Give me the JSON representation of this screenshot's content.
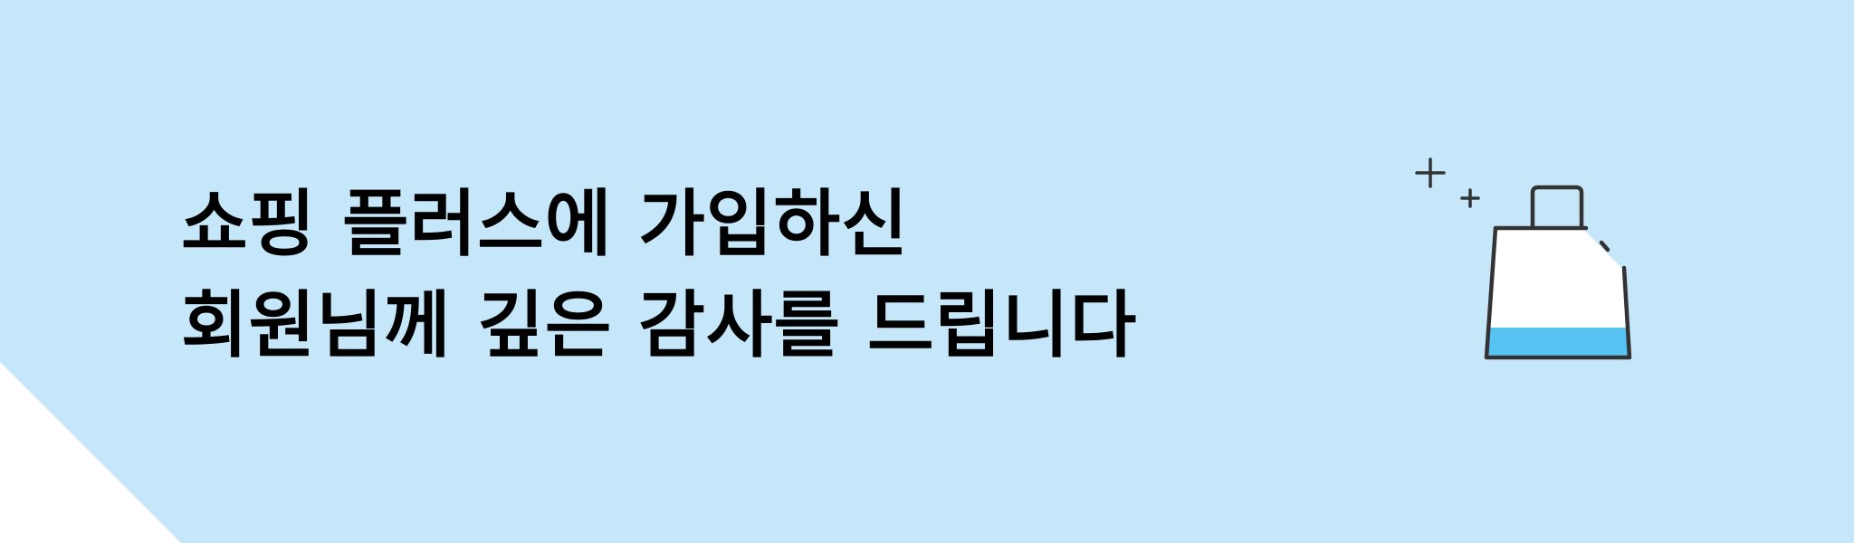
{
  "banner": {
    "headline_line_1": "쇼핑 플러스에 가입하신",
    "headline_line_2": "회원님께 깊은 감사를 드립니다"
  },
  "colors": {
    "background": "#c5e7f9",
    "corner": "#ffffff",
    "text": "#000000",
    "bag_fill": "#56c3f3",
    "bag_outline": "#333333"
  },
  "icons": {
    "illustration": "shopping-bag-icon",
    "decoration": "sparkle-icon"
  }
}
